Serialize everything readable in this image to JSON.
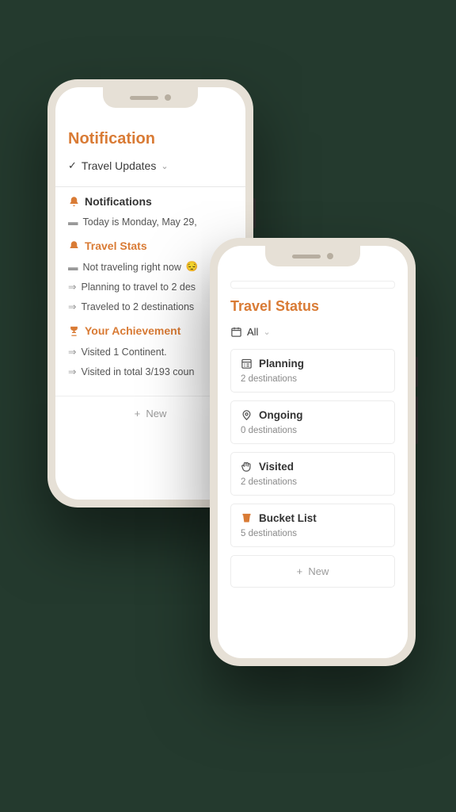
{
  "colors": {
    "accent": "#d97b35",
    "bg": "#243a2e"
  },
  "notification": {
    "title": "Notification",
    "dropdown_label": "Travel Updates",
    "sections": {
      "notifications_heading": "Notifications",
      "travel_stats_heading": "Travel Stats",
      "achievement_heading": "Your Achievement"
    },
    "lines": {
      "today": "Today is Monday, May 29,",
      "not_traveling": "Not traveling right now",
      "planning": "Planning to travel to 2 des",
      "traveled": "Traveled to 2 destinations",
      "continent": "Visited 1 Continent.",
      "countries": "Visited in total 3/193 coun"
    },
    "new_label": "New"
  },
  "travel_status": {
    "title": "Travel Status",
    "filter_label": "All",
    "cards": [
      {
        "icon": "calendar-list",
        "title": "Planning",
        "sub": "2 destinations"
      },
      {
        "icon": "map-pin",
        "title": "Ongoing",
        "sub": "0 destinations"
      },
      {
        "icon": "wave",
        "title": "Visited",
        "sub": "2 destinations"
      },
      {
        "icon": "bucket",
        "title": "Bucket List",
        "sub": "5 destinations"
      }
    ],
    "new_label": "New"
  }
}
